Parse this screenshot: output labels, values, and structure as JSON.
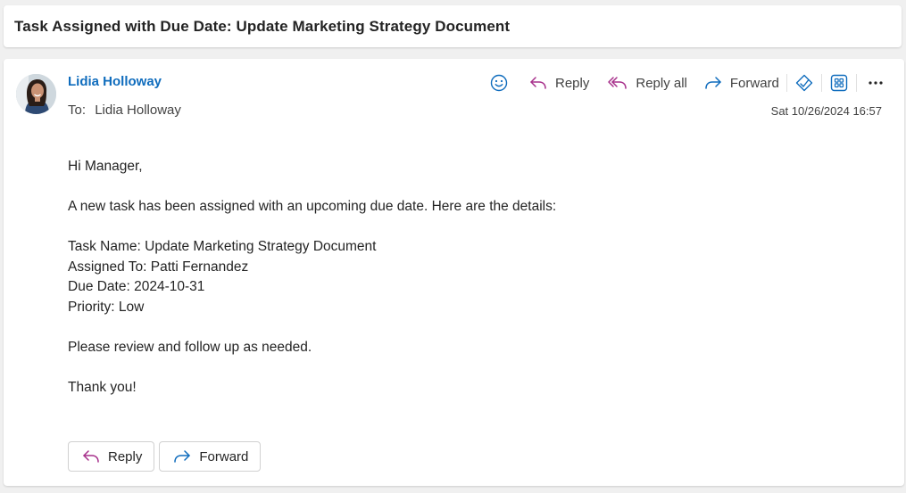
{
  "message": {
    "subject": "Task Assigned with Due Date: Update Marketing Strategy Document",
    "sender": "Lidia Holloway",
    "to_label": "To:",
    "recipient": "Lidia Holloway",
    "date": "Sat 10/26/2024 16:57"
  },
  "toolbar": {
    "reply_label": "Reply",
    "reply_all_label": "Reply all",
    "forward_label": "Forward",
    "icons": [
      "smiley-icon",
      "reply-icon",
      "reply-all-icon",
      "forward-icon",
      "immersive-reader-icon",
      "apps-icon",
      "more-icon"
    ]
  },
  "body": {
    "greeting": "Hi Manager,",
    "intro": "A new task has been assigned with an upcoming due date. Here are the details:",
    "details": [
      "Task Name: Update Marketing Strategy Document",
      "Assigned To: Patti Fernandez",
      "Due Date: 2024-10-31",
      "Priority: Low"
    ],
    "followup": "Please review and follow up as needed.",
    "closing": "Thank you!"
  },
  "bottom_actions": {
    "reply_label": "Reply",
    "forward_label": "Forward"
  },
  "colors": {
    "accent": "#0f6cbd",
    "reply_icon": "#a7308b",
    "forward_icon": "#0f6cbd"
  }
}
